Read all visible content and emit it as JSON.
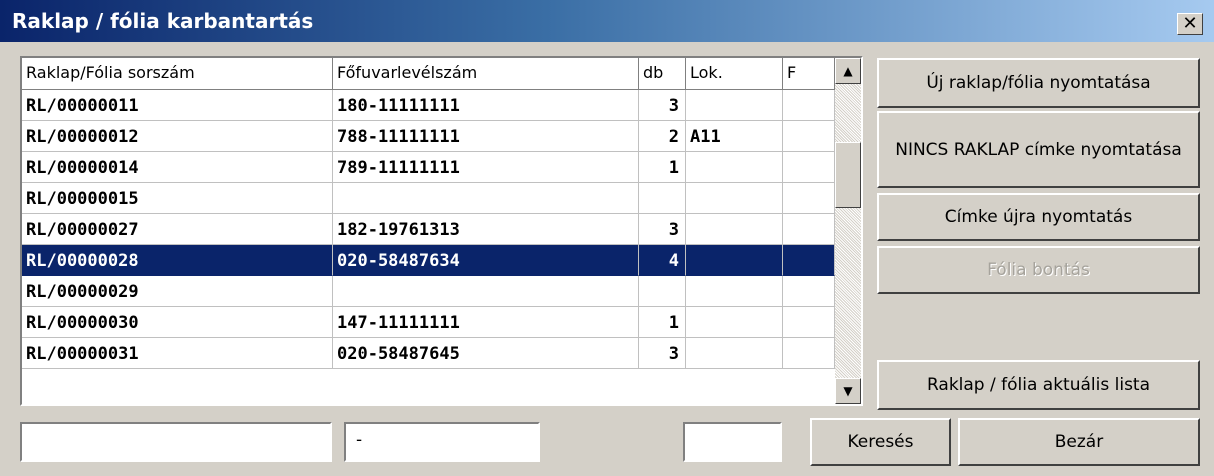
{
  "window": {
    "title": "Raklap / fólia karbantartás"
  },
  "grid": {
    "headers": [
      "Raklap/Fólia sorszám",
      "Főfuvarlevélszám",
      "db",
      "Lok.",
      "F"
    ],
    "rows": [
      {
        "sorszam": "RL/00000011",
        "fofuvar": "180-11111111",
        "db": "3",
        "lok": "",
        "f": ""
      },
      {
        "sorszam": "RL/00000012",
        "fofuvar": "788-11111111",
        "db": "2",
        "lok": "A11",
        "f": ""
      },
      {
        "sorszam": "RL/00000014",
        "fofuvar": "789-11111111",
        "db": "1",
        "lok": "",
        "f": ""
      },
      {
        "sorszam": "RL/00000015",
        "fofuvar": "",
        "db": "",
        "lok": "",
        "f": ""
      },
      {
        "sorszam": "RL/00000027",
        "fofuvar": "182-19761313",
        "db": "3",
        "lok": "",
        "f": ""
      },
      {
        "sorszam": "RL/00000028",
        "fofuvar": "020-58487634",
        "db": "4",
        "lok": "",
        "f": ""
      },
      {
        "sorszam": "RL/00000029",
        "fofuvar": "",
        "db": "",
        "lok": "",
        "f": ""
      },
      {
        "sorszam": "RL/00000030",
        "fofuvar": "147-11111111",
        "db": "1",
        "lok": "",
        "f": ""
      },
      {
        "sorszam": "RL/00000031",
        "fofuvar": "020-58487645",
        "db": "3",
        "lok": "",
        "f": ""
      }
    ],
    "selected_index": 5
  },
  "buttons": {
    "new_print": "Új raklap/fólia nyomtatása",
    "no_pallet_print": "NINCS RAKLAP címke nyomtatása",
    "reprint": "Címke újra nyomtatás",
    "split": "Fólia bontás",
    "current_list": "Raklap / fólia aktuális lista",
    "search": "Keresés",
    "close": "Bezár"
  },
  "filters": {
    "sorszam_value": "",
    "fofuvar_value": "-",
    "db_value": ""
  },
  "colors": {
    "title_start": "#0a246a",
    "title_end": "#a6caf0",
    "selection": "#0a246a",
    "face": "#d4d0c8"
  }
}
